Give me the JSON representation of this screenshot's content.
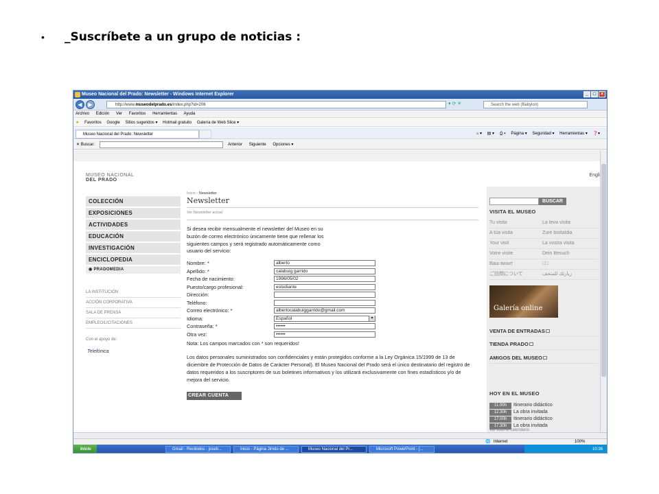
{
  "slide": {
    "bullet": "•",
    "title": "_Suscríbete a un grupo de noticias :"
  },
  "browser": {
    "window_title": "Museo Nacional del Prado: Newsletter - Windows Internet Explorer",
    "url_prefix": "http://www.",
    "url_domain": "museodelprado.es",
    "url_suffix": "/index.php?id=206",
    "search_placeholder": "Search the web (Babylon)",
    "menu": [
      "Archivo",
      "Edición",
      "Ver",
      "Favoritos",
      "Herramientas",
      "Ayuda"
    ],
    "favorites": [
      "Favoritos",
      "Google",
      "Sitios sugeridos ▾",
      "Hotmail gratuito",
      "Galería de Web Slice ▾"
    ],
    "tab_title": "Museo Nacional del Prado: Newsletter",
    "commands": [
      "Página ▾",
      "Seguridad ▾",
      "Herramientas ▾"
    ],
    "find_label": "✕ Buscar:",
    "find_links": [
      "Anterior",
      "Siguiente",
      "Opciones ▾"
    ],
    "status_zone": "Internet",
    "zoom": "100%"
  },
  "site": {
    "logo_line1": "MUSEO NACIONAL",
    "logo_line2": "DEL PRADO",
    "lang": "Engli",
    "nav": [
      "COLECCIÓN",
      "EXPOSICIONES",
      "ACTIVIDADES",
      "EDUCACIÓN",
      "INVESTIGACIÓN",
      "ENCICLOPEDIA"
    ],
    "nav_sub": "◉ PRADOMEDIA",
    "left_links": [
      "LA INSTITUCIÓN",
      "ACCIÓN CORPORATIVA",
      "SALA DE PRENSA",
      "EMPLEO/LICITACIONES"
    ],
    "support": "Con el apoyo de:",
    "sponsor": "Telefónica",
    "breadcrumb_home": "Inicio",
    "breadcrumb_sep": "›",
    "breadcrumb_current": "Newsletter",
    "page_title": "Newsletter",
    "ver_link": "Ver Newsletter actual",
    "intro": "Si desea recibir mensualmente el newsletter del Museo en su buzón de correo electrónico únicamente tiene que rellenar los siguientes campos y será registrado automáticamente como usuario del servicio:",
    "form": [
      {
        "label": "Nombre: *",
        "value": "alberto"
      },
      {
        "label": "Apellido: *",
        "value": "calabuig garrido"
      },
      {
        "label": "Fecha de nacimiento:",
        "value": "1996/05/02"
      },
      {
        "label": "Puesto/cargo profesional:",
        "value": "estudiante"
      },
      {
        "label": "Dirección:",
        "value": ""
      },
      {
        "label": "Teléfono:",
        "value": ""
      },
      {
        "label": "Correo electrónico: *",
        "value": "albertocalabuiggarrido@gmail.com"
      },
      {
        "label": "Idioma:",
        "value": "Español"
      },
      {
        "label": "Contraseña: *",
        "value": "••••••"
      },
      {
        "label": "Otra vez:",
        "value": "••••••"
      }
    ],
    "note": "Nota: Los campos marcados con * son requeridos!",
    "legal": "Los datos personales suministrados son confidenciales y están protegidos conforme a la Ley Orgánica 15/1999 de 13 de diciembre de Protección de Datos de Carácter Personal). El Museo Nacional del Prado será el único destinatario del registro de datos requeridos a los suscriptores de sus boletines informativos y los utilizará exclusivamente con fines estadísticos y/o de mejora del servicio.",
    "submit": "CREAR CUENTA",
    "search_btn": "BUSCAR",
    "visit_heading": "VISITA EL MUSEO",
    "visit": [
      [
        "Tu visita",
        "La teva visita"
      ],
      [
        "A túa visita",
        "Zure bisitaldia"
      ],
      [
        "Your visit",
        "La vostra visita"
      ],
      [
        "Votre visite",
        "Dein Besuch"
      ],
      [
        "Ваш визит",
        "□□"
      ],
      [
        "ご訪問について",
        "زيارتك للمتحف"
      ]
    ],
    "galeria": "Galería online",
    "venta": "VENTA DE ENTRADAS",
    "tienda": "TIENDA PRADO",
    "amigos": "AMIGOS DEL MUSEO",
    "hoy_heading": "HOY EN EL MUSEO",
    "hoy": [
      [
        "11.00h",
        "Itinerario didáctico"
      ],
      [
        "12.30h",
        "La obra invitada"
      ],
      [
        "17.00h",
        "Itinerario didáctico"
      ],
      [
        "17.30h",
        "La obra invitada"
      ]
    ],
    "ver_todo": "Ver todo el calendario"
  },
  "taskbar": {
    "start": "Inicio",
    "items": [
      "Gmail - Recibidos - joseb...",
      "Inicio - Página Jimdo de ...",
      "Museo Nacional del Pr...",
      "Microsoft PowerPoint - [..."
    ],
    "clock": "10:36"
  }
}
